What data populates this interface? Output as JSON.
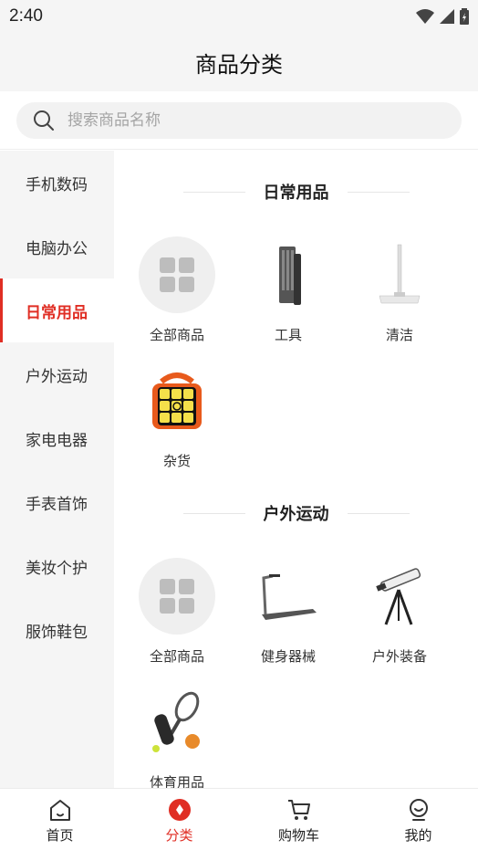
{
  "status_bar": {
    "time": "2:40"
  },
  "header": {
    "title": "商品分类"
  },
  "search": {
    "placeholder": "搜索商品名称"
  },
  "sidebar": {
    "items": [
      {
        "label": "手机数码"
      },
      {
        "label": "电脑办公"
      },
      {
        "label": "日常用品"
      },
      {
        "label": "户外运动"
      },
      {
        "label": "家电电器"
      },
      {
        "label": "手表首饰"
      },
      {
        "label": "美妆个护"
      },
      {
        "label": "服饰鞋包"
      }
    ],
    "active": "日常用品"
  },
  "sections": [
    {
      "title": "日常用品",
      "items": [
        {
          "label": "全部商品",
          "icon": "grid-icon"
        },
        {
          "label": "工具",
          "icon": "screwdriver-set-icon"
        },
        {
          "label": "清洁",
          "icon": "mop-icon"
        },
        {
          "label": "杂货",
          "icon": "rubiks-cube-icon"
        }
      ]
    },
    {
      "title": "户外运动",
      "items": [
        {
          "label": "全部商品",
          "icon": "grid-icon"
        },
        {
          "label": "健身器械",
          "icon": "treadmill-icon"
        },
        {
          "label": "户外装备",
          "icon": "telescope-icon"
        },
        {
          "label": "体育用品",
          "icon": "tennis-racket-icon"
        }
      ]
    }
  ],
  "tabbar": {
    "items": [
      {
        "label": "首页",
        "icon": "home-icon"
      },
      {
        "label": "分类",
        "icon": "category-icon"
      },
      {
        "label": "购物车",
        "icon": "cart-icon"
      },
      {
        "label": "我的",
        "icon": "profile-icon"
      }
    ],
    "active": "分类"
  },
  "colors": {
    "accent": "#e02e24",
    "sidebar_bg": "#f5f5f5"
  }
}
